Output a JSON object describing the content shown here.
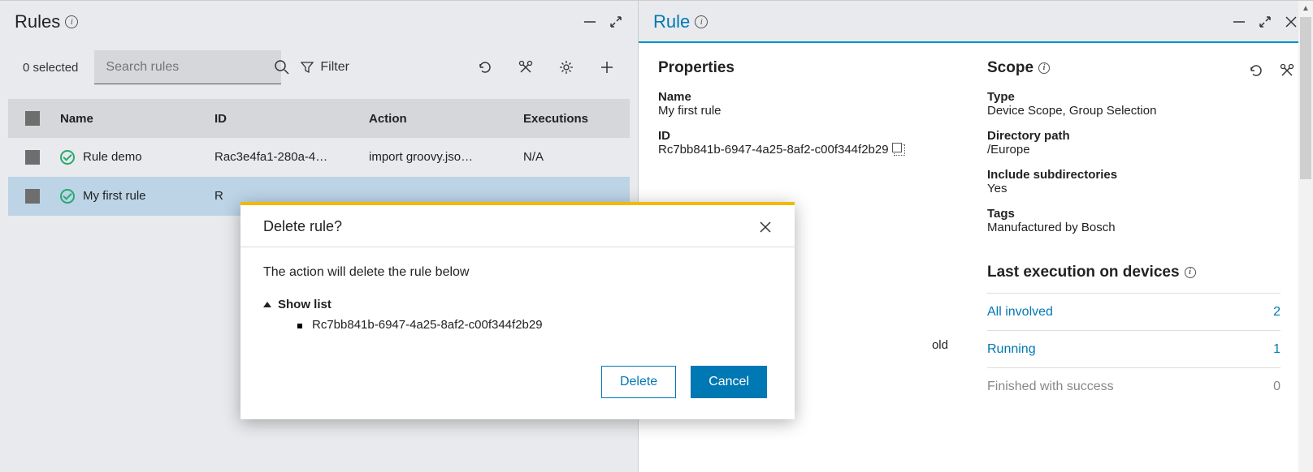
{
  "left": {
    "title": "Rules",
    "selected_text": "0 selected",
    "search_placeholder": "Search rules",
    "filter_label": "Filter",
    "columns": {
      "name": "Name",
      "id": "ID",
      "action": "Action",
      "executions": "Executions"
    },
    "rows": [
      {
        "name": "Rule demo",
        "id": "Rac3e4fa1-280a-4…",
        "action": "import groovy.jso…",
        "executions": "N/A",
        "selected": false
      },
      {
        "name": "My first rule",
        "id": "R",
        "action": "",
        "executions": "",
        "selected": true
      }
    ]
  },
  "right": {
    "title": "Rule",
    "properties": {
      "section": "Properties",
      "name_label": "Name",
      "name_value": "My first rule",
      "id_label": "ID",
      "id_value": "Rc7bb841b-6947-4a25-8af2-c00f344f2b29"
    },
    "scope": {
      "section": "Scope",
      "type_label": "Type",
      "type_value": "Device Scope, Group Selection",
      "path_label": "Directory path",
      "path_value": "/Europe",
      "subdir_label": "Include subdirectories",
      "subdir_value": "Yes",
      "tags_label": "Tags",
      "tags_value": "Manufactured by Bosch"
    },
    "truncated_text": "old",
    "exec": {
      "section": "Last execution on devices",
      "rows": [
        {
          "label": "All involved",
          "value": "2",
          "link": true
        },
        {
          "label": "Running",
          "value": "1",
          "link": true
        },
        {
          "label": "Finished with success",
          "value": "0",
          "link": false
        }
      ]
    }
  },
  "dialog": {
    "title": "Delete rule?",
    "message": "The action will delete the rule below",
    "show_list": "Show list",
    "items": [
      "Rc7bb841b-6947-4a25-8af2-c00f344f2b29"
    ],
    "delete": "Delete",
    "cancel": "Cancel"
  }
}
